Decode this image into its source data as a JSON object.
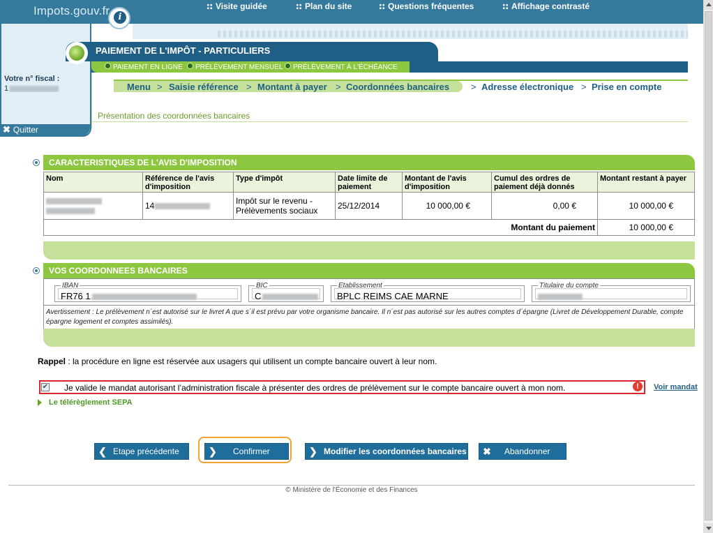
{
  "header": {
    "logo": "Impots.gouv.fr",
    "info_icon": "info-icon",
    "links": [
      "Visite guidée",
      "Plan du site",
      "Questions fréquentes",
      "Affichage contrasté"
    ]
  },
  "left_panel": {
    "fiscal_label": "Votre n° fiscal :",
    "fiscal_value_prefix": "1",
    "quit_label": "Quitter"
  },
  "title": "PAIEMENT DE L'IMPÔT - PARTICULIERS",
  "tabs": [
    "PAIEMENT EN LIGNE",
    "PRÉLÈVEMENT MENSUEL",
    "PRÉLÈVEMENT À L'ÉCHÉANCE"
  ],
  "steps": [
    "Menu",
    "Saisie référence",
    "Montant à payer",
    "Coordonnées bancaires",
    "Adresse électronique",
    "Prise en compte"
  ],
  "step_separator": ">",
  "subtitle": "Présentation des coordonnées bancaires",
  "avis": {
    "title": "CARACTERISTIQUES DE L'AVIS D'IMPOSITION",
    "columns": [
      "Nom",
      "Référence de l'avis d'imposition",
      "Type d'impôt",
      "Date limite de paiement",
      "Montant de l'avis d'imposition",
      "Cumul des ordres de paiement déjà donnés",
      "Montant restant à payer"
    ],
    "row": {
      "reference_prefix": "14",
      "type": "Impôt sur le revenu - Prélèvements sociaux",
      "date": "25/12/2014",
      "montant": "10 000,00 €",
      "cumul": "0,00 €",
      "restant": "10 000,00 €"
    },
    "total_label": "Montant du paiement",
    "total_value": "10 000,00 €"
  },
  "bank": {
    "title": "VOS COORDONNEES BANCAIRES",
    "iban_label": "IBAN",
    "iban_value": "FR76 1",
    "bic_label": "BIC",
    "bic_value": "C",
    "etab_label": "Etablissement",
    "etab_value": "BPLC REIMS CAE MARNE",
    "titulaire_label": "Titulaire du compte",
    "warning": "Avertissement :   Le prélèvement n´est autorisé sur le livret A que s´il est prévu par votre organisme bancaire. Il n´est pas autorisé sur les autres comptes d´épargne (Livret de Développement Durable, compte épargne logement et comptes assimilés)."
  },
  "rappel": {
    "bold": "Rappel",
    "text": " : la procédure en ligne est réservée aux usagers qui utilisent un compte bancaire ouvert à leur nom."
  },
  "mandate": {
    "checked": true,
    "text": "Je valide le mandat autorisant l’administration fiscale à présenter des ordres de prélèvement sur le compte bancaire ouvert à mon nom.",
    "alert_icon": "alert-icon",
    "link": "Voir mandat"
  },
  "sepa_link": "Le télérèglement SEPA",
  "buttons": {
    "previous": "Etape précédente",
    "confirm": "Confirmer",
    "modify": "Modifier les coordonnées bancaires",
    "cancel": "Abandonner"
  },
  "footer": "© Ministère de l'Économie et des Finances",
  "colors": {
    "primary_blue": "#1f5f86",
    "header_blue": "#35799d",
    "green": "#8dc63f",
    "light_green": "#c5e09a",
    "alert_red": "#d9262c",
    "focus_orange": "#f1a231"
  }
}
